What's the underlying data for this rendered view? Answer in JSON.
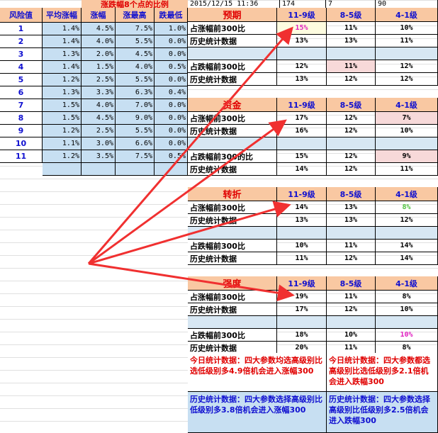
{
  "top": {
    "title": "涨跌幅8个点的比例",
    "datetime": "2015/12/15 11:36",
    "n1": "174",
    "n2": "7",
    "n3": "90"
  },
  "left_table": {
    "headers": [
      "风险值",
      "平均涨幅",
      "涨幅",
      "涨最高",
      "跌最低"
    ],
    "rows": [
      [
        "1",
        "1.4%",
        "4.5%",
        "7.5%",
        "1.0%"
      ],
      [
        "2",
        "1.4%",
        "4.0%",
        "5.5%",
        "0.0%"
      ],
      [
        "3",
        "1.3%",
        "2.0%",
        "4.5%",
        "0.0%"
      ],
      [
        "4",
        "1.4%",
        "1.5%",
        "4.0%",
        "0.5%"
      ],
      [
        "5",
        "1.2%",
        "2.5%",
        "5.5%",
        "0.0%"
      ],
      [
        "6",
        "1.3%",
        "3.3%",
        "6.3%",
        "0.4%"
      ],
      [
        "7",
        "1.5%",
        "4.0%",
        "7.0%",
        "0.0%"
      ],
      [
        "8",
        "1.5%",
        "4.5%",
        "9.0%",
        "0.0%"
      ],
      [
        "9",
        "1.2%",
        "2.5%",
        "5.5%",
        "0.0%"
      ],
      [
        "10",
        "1.1%",
        "3.0%",
        "6.6%",
        "0.0%"
      ],
      [
        "11",
        "1.2%",
        "3.5%",
        "7.5%",
        "0.5%"
      ]
    ]
  },
  "sections": [
    {
      "title": "预期",
      "cols": [
        "11-9级",
        "8-5级",
        "4-1级"
      ],
      "rows": [
        {
          "label": "占涨幅前300比",
          "v": [
            "15%",
            "11%",
            "10%"
          ]
        },
        {
          "label": "历史统计数据",
          "v": [
            "13%",
            "13%",
            "11%"
          ]
        },
        {
          "label": "",
          "v": [
            "",
            "",
            ""
          ]
        },
        {
          "label": "占跌幅前300比",
          "v": [
            "12%",
            "11%",
            "12%"
          ]
        },
        {
          "label": "历史统计数据",
          "v": [
            "13%",
            "12%",
            "12%"
          ]
        }
      ]
    },
    {
      "title": "资金",
      "cols": [
        "11-9级",
        "8-5级",
        "4-1级"
      ],
      "rows": [
        {
          "label": "占涨幅前300比",
          "v": [
            "17%",
            "12%",
            "7%"
          ]
        },
        {
          "label": "历史统计数据",
          "v": [
            "16%",
            "12%",
            "10%"
          ]
        },
        {
          "label": "",
          "v": [
            "",
            "",
            ""
          ]
        },
        {
          "label": "占跌幅前300的比",
          "v": [
            "15%",
            "12%",
            "9%"
          ]
        },
        {
          "label": "历史统计数据",
          "v": [
            "14%",
            "12%",
            "11%"
          ]
        }
      ]
    },
    {
      "title": "转折",
      "cols": [
        "11-9级",
        "8-5级",
        "4-1级"
      ],
      "rows": [
        {
          "label": "占涨幅前300比",
          "v": [
            "14%",
            "13%",
            "8%"
          ]
        },
        {
          "label": "历史统计数据",
          "v": [
            "13%",
            "13%",
            "12%"
          ]
        },
        {
          "label": "",
          "v": [
            "",
            "",
            ""
          ]
        },
        {
          "label": "占跌幅前300比",
          "v": [
            "10%",
            "11%",
            "14%"
          ]
        },
        {
          "label": "历史统计数据",
          "v": [
            "11%",
            "12%",
            "14%"
          ]
        }
      ]
    },
    {
      "title": "强度",
      "cols": [
        "11-9级",
        "8-5级",
        "4-1级"
      ],
      "rows": [
        {
          "label": "占涨幅前300比",
          "v": [
            "19%",
            "11%",
            "8%"
          ]
        },
        {
          "label": "历史统计数据",
          "v": [
            "17%",
            "12%",
            "10%"
          ]
        },
        {
          "label": "",
          "v": [
            "",
            "",
            ""
          ]
        },
        {
          "label": "占跌幅前300比",
          "v": [
            "18%",
            "10%",
            "10%"
          ]
        },
        {
          "label": "历史统计数据",
          "v": [
            "20%",
            "11%",
            "8%"
          ]
        }
      ]
    }
  ],
  "notes": {
    "today_up": "今日统计数据：四大参数均选高级别比选低级别多4.9倍机会进入涨幅300",
    "today_down": "今日统计数据：四大参数都选高级别比选低级别多2.1倍机会进入跌幅300",
    "hist_up": "历史统计数据：四大参数选择高级别比低级别多3.8倍机会进入涨幅300",
    "hist_down": "历史统计数据：四大参数选择高级别比低级别多2.5倍机会进入跌幅300"
  },
  "colors": {
    "header_bg": "#f9c8a2",
    "blue_cell": "#c7dff2",
    "pink_cell": "#f7d9d9",
    "arrow": "#f03030",
    "accent_magenta": "#e020c0",
    "accent_green": "#50c040"
  }
}
